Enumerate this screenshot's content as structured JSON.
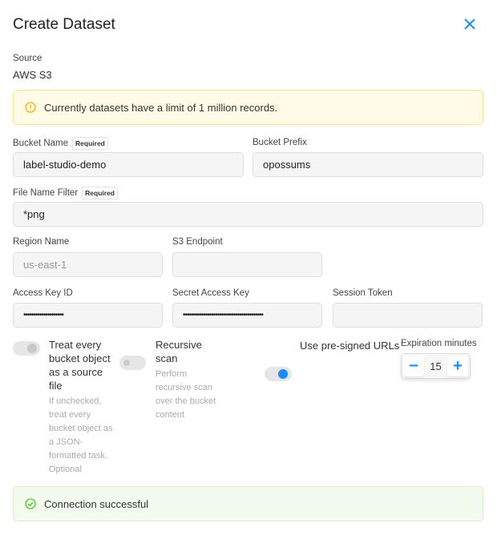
{
  "title": "Create Dataset",
  "source": {
    "label": "Source",
    "value": "AWS S3"
  },
  "warning": "Currently datasets have a limit of 1 million records.",
  "required_badge": "Required",
  "fields": {
    "bucket_name": {
      "label": "Bucket Name",
      "value": "label-studio-demo"
    },
    "bucket_prefix": {
      "label": "Bucket Prefix",
      "value": "opossums"
    },
    "file_filter": {
      "label": "File Name Filter",
      "value": "*png"
    },
    "region": {
      "label": "Region Name",
      "value": "",
      "placeholder": "us-east-1"
    },
    "s3_endpoint": {
      "label": "S3 Endpoint",
      "value": ""
    },
    "access_key": {
      "label": "Access Key ID",
      "value": "••••••••••••••••••••"
    },
    "secret_key": {
      "label": "Secret Access Key",
      "value": "••••••••••••••••••••••••••••••••••••••••"
    },
    "session_token": {
      "label": "Session Token",
      "value": ""
    }
  },
  "toggles": {
    "treat_source": {
      "label": "Treat every bucket object as a source file",
      "hint": "If unchecked, treat every bucket object as a JSON-formatted task. Optional",
      "checked": true,
      "disabled": true
    },
    "recursive": {
      "label": "Recursive scan",
      "hint": "Perform recursive scan over the bucket content",
      "checked": false
    },
    "presigned": {
      "label": "Use pre-signed URLs",
      "checked": true
    }
  },
  "expiration": {
    "label": "Expiration minutes",
    "value": "15",
    "minus": "−",
    "plus": "+"
  },
  "success": "Connection successful",
  "colors": {
    "accent": "#1a8cff",
    "warning_bg": "#fffbe6",
    "success_bg": "#f3fbef"
  }
}
